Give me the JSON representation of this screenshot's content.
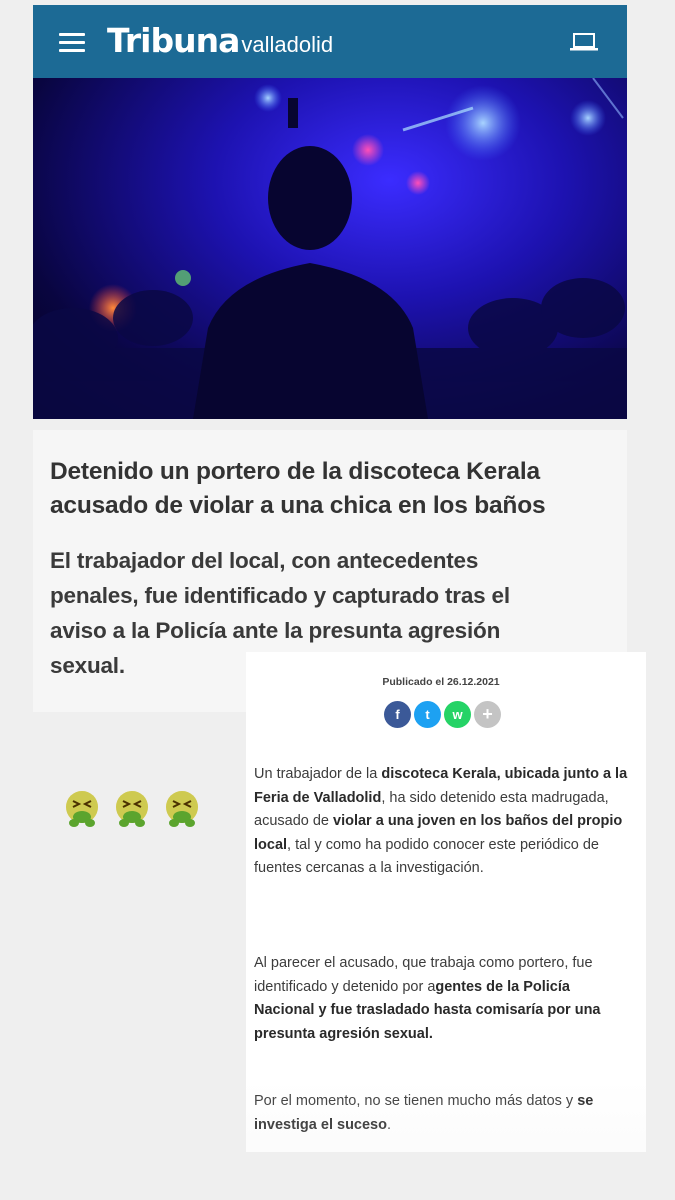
{
  "header": {
    "brand_name": "Tribuna",
    "brand_city": "valladolid",
    "menu_icon": "hamburger-menu-icon",
    "device_icon": "laptop-icon",
    "color": "#1c6a95"
  },
  "article": {
    "headline": "Detenido un portero de la discoteca Kerala acusado de violar a una chica en los baños",
    "subheadline": "El trabajador del local, con antecedentes penales, fue identificado y capturado tras el aviso a la Policía ante la presunta agresión sexual.",
    "published": "Publicado el 26.12.2021",
    "share": [
      {
        "icon": "facebook-icon",
        "label": "f",
        "color": "#3b5998"
      },
      {
        "icon": "twitter-icon",
        "label": "t",
        "color": "#1da1f2"
      },
      {
        "icon": "whatsapp-icon",
        "label": "w",
        "color": "#25d366"
      },
      {
        "icon": "more-icon",
        "label": "+",
        "color": "#c4c4c4"
      }
    ],
    "p1": [
      {
        "t": "Un trabajador de la ",
        "b": false
      },
      {
        "t": "discoteca Kerala, ubicada junto a la Feria de Valladolid",
        "b": true
      },
      {
        "t": ", ha sido detenido esta madrugada, acusado de ",
        "b": false
      },
      {
        "t": "violar a una joven en los baños del propio local",
        "b": true
      },
      {
        "t": ", tal y como ha podido conocer este periódico de fuentes cercanas a la investigación.",
        "b": false
      }
    ],
    "p2": [
      {
        "t": "Al parecer el acusado, que trabaja como portero, fue identificado y detenido por a",
        "b": false
      },
      {
        "t": "gentes de la Policía Nacional y fue trasladado hasta comisaría por una presunta agresión sexual.",
        "b": true
      }
    ],
    "p3": [
      {
        "t": "Por el momento, no se tienen mucho más datos y ",
        "b": false
      },
      {
        "t": "se investiga el suceso",
        "b": true
      },
      {
        "t": ".",
        "b": false
      }
    ]
  },
  "overlay": {
    "emojis": [
      "nauseated-face-emoji",
      "nauseated-face-emoji",
      "nauseated-face-emoji"
    ]
  }
}
